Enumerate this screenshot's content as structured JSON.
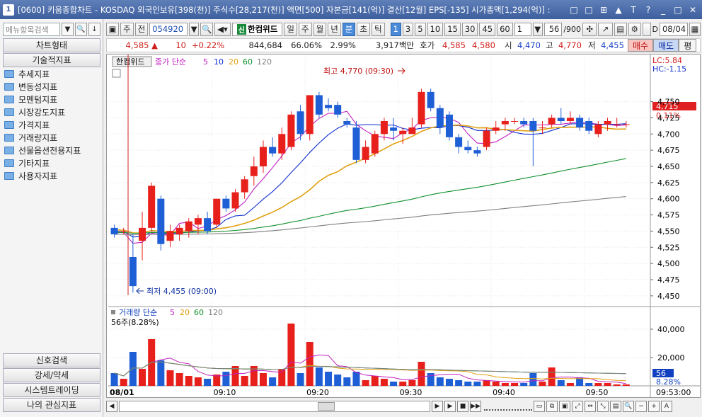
{
  "window": {
    "app_num": "1",
    "title": "[0600] 키움종합차트 - KOSDAQ 외국인보유[398(천)] 주식수[28,217(천)] 액면[500] 자본금[141(억)] 결산[12월] EPS[-135] 시가총액[1,294(억)] :",
    "buttons": [
      "□",
      "□",
      "⊞",
      "▲",
      "T",
      "?",
      "_",
      "□",
      "✕"
    ]
  },
  "sidebar": {
    "search_placeholder": "메뉴항목검색",
    "chart_type_label": "차트형태",
    "tech_label": "기술적지표",
    "items": [
      "추세지표",
      "변동성지표",
      "모멘텀지표",
      "시장강도지표",
      "가격지표",
      "거래량지표",
      "선물옵션전용지표",
      "기타지표",
      "사용자지표"
    ],
    "bottom_items": [
      "신호검색",
      "강세/약세",
      "시스템트레이딩",
      "나의 관심지표"
    ]
  },
  "toolbar": {
    "period_btn": "주",
    "prev_btn": "전",
    "code": "054920",
    "stock_name": "한컴위드",
    "hk_badge": "신",
    "periods": [
      "일",
      "주",
      "월",
      "년",
      "분",
      "초",
      "틱"
    ],
    "minutes": [
      "1",
      "3",
      "5",
      "10",
      "15",
      "30",
      "45",
      "60"
    ],
    "active_minute": "1",
    "period_unit": "1",
    "count": "56",
    "max_count": "/900",
    "date_label": "D",
    "date_value": "08/04"
  },
  "quote": {
    "price": "4,585",
    "arrow": "▲",
    "change": "10",
    "change_pct": "+0.22%",
    "volume": "844,684",
    "vol_ratio": "66.06%",
    "turnover": "2.99%",
    "amount": "3,917백만",
    "ask_label": "호가",
    "ask1": "4,585",
    "ask2": "4,580",
    "open_label": "시",
    "open": "4,470",
    "high_label": "고",
    "high": "4,770",
    "low_label": "저",
    "low": "4,455",
    "buy": "매수",
    "sell": "매도",
    "eval": "평"
  },
  "price_panel": {
    "stock_label": "한컴위드",
    "ma_label": "종가 단순",
    "ma_periods": [
      "5",
      "10",
      "20",
      "60",
      "120"
    ],
    "ma_colors": [
      "#c020c0",
      "#1030d0",
      "#e0a010",
      "#10902c",
      "#808080"
    ],
    "high_annot": "최고 4,770 (09:30)",
    "low_annot": "최저 4,455 (09:00)",
    "lc_label": "LC:5.84",
    "hc_label": "HC:-1.15",
    "last_price": "4,715",
    "last_pct": "0.11%"
  },
  "volume_panel": {
    "label": "거래량 단순",
    "ma_periods": [
      "5",
      "20",
      "60",
      "120"
    ],
    "last_vol_label": "56주(8.28%)",
    "last_value_tag": "56",
    "pct_tag": "8.28%"
  },
  "time_axis": {
    "date": "08/01",
    "ticks": [
      "09:10",
      "09:20",
      "09:30",
      "09:40",
      "09:50"
    ],
    "clock": "09:53:00"
  },
  "chart_data": {
    "type": "candlestick",
    "price_ticks": [
      4750,
      4725,
      4700,
      4675,
      4650,
      4625,
      4600,
      4575,
      4550,
      4525,
      4500,
      4475,
      4450
    ],
    "ylim": [
      4440,
      4790
    ],
    "vol_ticks": [
      "40,000",
      "20,000"
    ],
    "vol_ylim": [
      0,
      48000
    ],
    "candles": [
      {
        "o": 4555,
        "h": 4560,
        "l": 4540,
        "c": 4545,
        "v": 9000
      },
      {
        "o": 4550,
        "h": 4555,
        "l": 4545,
        "c": 4550,
        "v": 5000
      },
      {
        "o": 4510,
        "h": 4545,
        "l": 4455,
        "c": 4465,
        "v": 24000
      },
      {
        "o": 4535,
        "h": 4580,
        "l": 4505,
        "c": 4555,
        "v": 12000
      },
      {
        "o": 4555,
        "h": 4625,
        "l": 4550,
        "c": 4620,
        "v": 33000
      },
      {
        "o": 4600,
        "h": 4605,
        "l": 4520,
        "c": 4530,
        "v": 18000
      },
      {
        "o": 4535,
        "h": 4560,
        "l": 4525,
        "c": 4550,
        "v": 11000
      },
      {
        "o": 4545,
        "h": 4560,
        "l": 4535,
        "c": 4555,
        "v": 9000
      },
      {
        "o": 4550,
        "h": 4570,
        "l": 4540,
        "c": 4565,
        "v": 7000
      },
      {
        "o": 4560,
        "h": 4575,
        "l": 4545,
        "c": 4570,
        "v": 6000
      },
      {
        "o": 4570,
        "h": 4580,
        "l": 4545,
        "c": 4550,
        "v": 5000
      },
      {
        "o": 4560,
        "h": 4600,
        "l": 4555,
        "c": 4600,
        "v": 8000
      },
      {
        "o": 4600,
        "h": 4605,
        "l": 4580,
        "c": 4585,
        "v": 10000
      },
      {
        "o": 4585,
        "h": 4615,
        "l": 4580,
        "c": 4610,
        "v": 14000
      },
      {
        "o": 4610,
        "h": 4635,
        "l": 4600,
        "c": 4630,
        "v": 7000
      },
      {
        "o": 4635,
        "h": 4665,
        "l": 4620,
        "c": 4650,
        "v": 14000
      },
      {
        "o": 4650,
        "h": 4690,
        "l": 4640,
        "c": 4680,
        "v": 9000
      },
      {
        "o": 4680,
        "h": 4695,
        "l": 4665,
        "c": 4670,
        "v": 6000
      },
      {
        "o": 4670,
        "h": 4710,
        "l": 4660,
        "c": 4700,
        "v": 12000
      },
      {
        "o": 4680,
        "h": 4735,
        "l": 4675,
        "c": 4730,
        "v": 44000
      },
      {
        "o": 4735,
        "h": 4745,
        "l": 4690,
        "c": 4700,
        "v": 9000
      },
      {
        "o": 4700,
        "h": 4760,
        "l": 4690,
        "c": 4760,
        "v": 31000
      },
      {
        "o": 4760,
        "h": 4765,
        "l": 4725,
        "c": 4730,
        "v": 13000
      },
      {
        "o": 4745,
        "h": 4755,
        "l": 4735,
        "c": 4740,
        "v": 10000
      },
      {
        "o": 4745,
        "h": 4750,
        "l": 4725,
        "c": 4730,
        "v": 8000
      },
      {
        "o": 4720,
        "h": 4725,
        "l": 4710,
        "c": 4715,
        "v": 6000
      },
      {
        "o": 4710,
        "h": 4720,
        "l": 4655,
        "c": 4660,
        "v": 10000
      },
      {
        "o": 4660,
        "h": 4690,
        "l": 4655,
        "c": 4680,
        "v": 4000
      },
      {
        "o": 4670,
        "h": 4705,
        "l": 4665,
        "c": 4700,
        "v": 7000
      },
      {
        "o": 4700,
        "h": 4725,
        "l": 4690,
        "c": 4720,
        "v": 5000
      },
      {
        "o": 4710,
        "h": 4725,
        "l": 4690,
        "c": 4705,
        "v": 3000
      },
      {
        "o": 4700,
        "h": 4710,
        "l": 4685,
        "c": 4705,
        "v": 3000
      },
      {
        "o": 4700,
        "h": 4725,
        "l": 4700,
        "c": 4710,
        "v": 4000
      },
      {
        "o": 4715,
        "h": 4770,
        "l": 4710,
        "c": 4765,
        "v": 17000
      },
      {
        "o": 4765,
        "h": 4770,
        "l": 4735,
        "c": 4740,
        "v": 9000
      },
      {
        "o": 4740,
        "h": 4745,
        "l": 4700,
        "c": 4710,
        "v": 6000
      },
      {
        "o": 4730,
        "h": 4735,
        "l": 4690,
        "c": 4695,
        "v": 5000
      },
      {
        "o": 4695,
        "h": 4700,
        "l": 4670,
        "c": 4680,
        "v": 4000
      },
      {
        "o": 4680,
        "h": 4690,
        "l": 4670,
        "c": 4675,
        "v": 3000
      },
      {
        "o": 4675,
        "h": 4680,
        "l": 4665,
        "c": 4670,
        "v": 3000
      },
      {
        "o": 4680,
        "h": 4710,
        "l": 4675,
        "c": 4705,
        "v": 4000
      },
      {
        "o": 4705,
        "h": 4720,
        "l": 4700,
        "c": 4710,
        "v": 3000
      },
      {
        "o": 4715,
        "h": 4725,
        "l": 4705,
        "c": 4720,
        "v": 2000
      },
      {
        "o": 4720,
        "h": 4725,
        "l": 4715,
        "c": 4720,
        "v": 2000
      },
      {
        "o": 4720,
        "h": 4725,
        "l": 4710,
        "c": 4715,
        "v": 2000
      },
      {
        "o": 4720,
        "h": 4725,
        "l": 4650,
        "c": 4705,
        "v": 9000
      },
      {
        "o": 4710,
        "h": 4720,
        "l": 4700,
        "c": 4710,
        "v": 3000
      },
      {
        "o": 4715,
        "h": 4730,
        "l": 4710,
        "c": 4725,
        "v": 13000
      },
      {
        "o": 4725,
        "h": 4740,
        "l": 4715,
        "c": 4720,
        "v": 4000
      },
      {
        "o": 4720,
        "h": 4735,
        "l": 4715,
        "c": 4725,
        "v": 2000
      },
      {
        "o": 4725,
        "h": 4730,
        "l": 4705,
        "c": 4710,
        "v": 6000
      },
      {
        "o": 4720,
        "h": 4725,
        "l": 4700,
        "c": 4705,
        "v": 2000
      },
      {
        "o": 4700,
        "h": 4720,
        "l": 4695,
        "c": 4715,
        "v": 2000
      },
      {
        "o": 4715,
        "h": 4725,
        "l": 4705,
        "c": 4720,
        "v": 2000
      },
      {
        "o": 4715,
        "h": 4725,
        "l": 4710,
        "c": 4715,
        "v": 1000
      },
      {
        "o": 4715,
        "h": 4720,
        "l": 4710,
        "c": 4715,
        "v": 1000
      }
    ]
  }
}
